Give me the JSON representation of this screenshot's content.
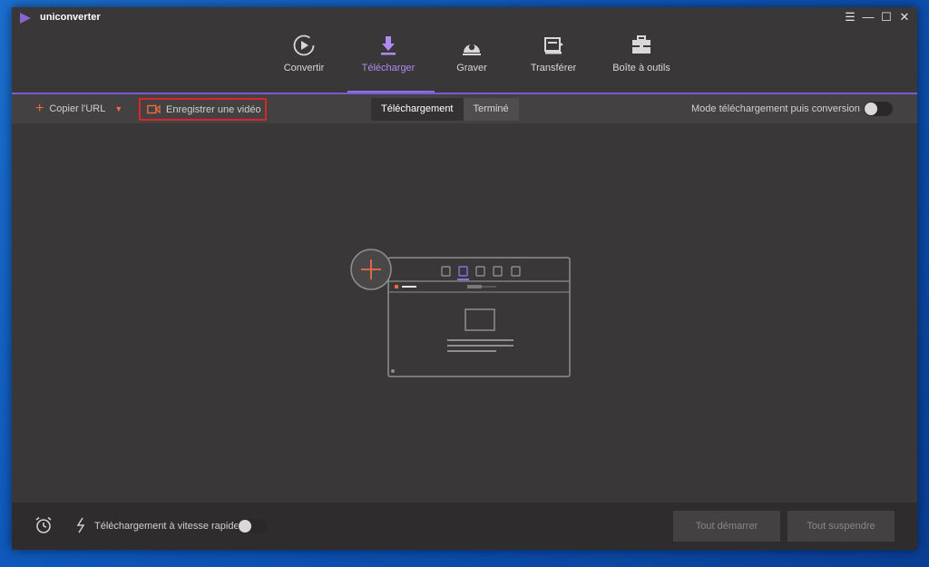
{
  "app": {
    "title": "uniconverter"
  },
  "window_controls": {
    "menu": "☰",
    "minimize": "—",
    "maximize": "☐",
    "close": "✕"
  },
  "nav": {
    "items": [
      {
        "label": "Convertir",
        "icon": "convert-icon"
      },
      {
        "label": "Télécharger",
        "icon": "download-icon",
        "active": true
      },
      {
        "label": "Graver",
        "icon": "burn-disc-icon"
      },
      {
        "label": "Transférer",
        "icon": "transfer-icon"
      },
      {
        "label": "Boîte à outils",
        "icon": "toolbox-icon"
      }
    ]
  },
  "toolbar": {
    "copy_url": "Copier l'URL",
    "record_video": "Enregistrer une vidéo",
    "tabs": [
      {
        "label": "Téléchargement",
        "active": true
      },
      {
        "label": "Terminé",
        "active": false
      }
    ],
    "mode_label": "Mode téléchargement puis conversion",
    "mode_enabled": false
  },
  "bottom": {
    "fast_download_label": "Téléchargement à vitesse rapide",
    "fast_download_enabled": false,
    "start_all": "Tout démarrer",
    "pause_all": "Tout suspendre"
  },
  "colors": {
    "accent": "#8c6fe0",
    "orange": "#ef6a43",
    "highlight_box": "#d9262a",
    "window_bg": "#3a3738"
  }
}
